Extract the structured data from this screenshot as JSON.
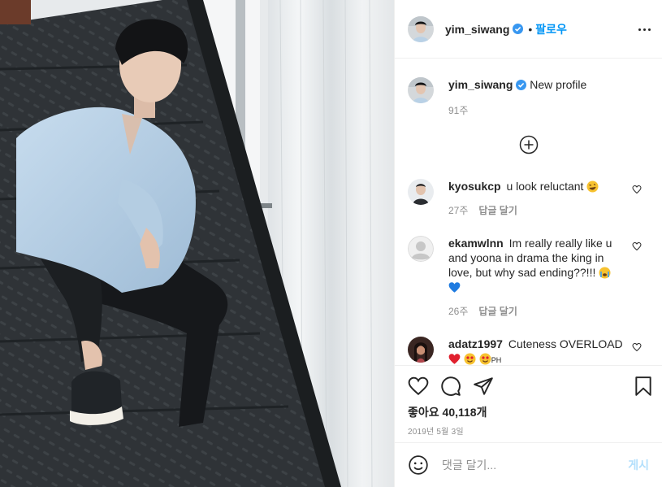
{
  "post": {
    "username": "yim_siwang",
    "follow_label": "팔로우",
    "dot": "•",
    "caption_text": "New profile",
    "caption_time": "91주"
  },
  "comments": [
    {
      "username": "kyosukcp",
      "text": "u look reluctant",
      "time": "27주",
      "reply": "답글 달기"
    },
    {
      "username": "ekamwlnn",
      "text": "Im really really like u and yoona in drama the king in love, but why sad ending??!!!",
      "time": "26주",
      "reply": "답글 달기"
    },
    {
      "username": "adatz1997",
      "text": "Cuteness OVERLOAD",
      "tail": "PH"
    }
  ],
  "engagement": {
    "likes": "좋아요 40,118개",
    "date": "2019년 5월 3일"
  },
  "composer": {
    "placeholder": "댓글 달기...",
    "post_label": "게시"
  },
  "icons": {
    "more": "more-options-icon",
    "verified": "verified-badge-icon",
    "load_more": "plus-circle-icon",
    "like": "heart-icon",
    "comment": "comment-bubble-icon",
    "share": "paper-plane-icon",
    "save": "bookmark-icon",
    "emoji": "smiley-icon"
  },
  "colors": {
    "link_blue": "#0095f6",
    "verified_blue": "#3897f0",
    "muted": "#8e8e8e",
    "post_disabled": "#b2dffc",
    "divider": "#efefef"
  }
}
